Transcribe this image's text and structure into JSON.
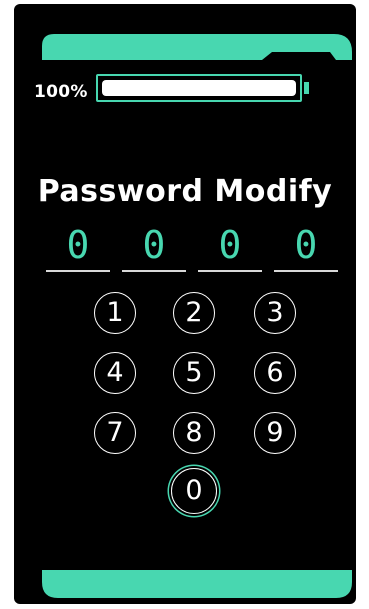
{
  "colors": {
    "accent": "#48d7b0",
    "background": "#000000",
    "text": "#ffffff"
  },
  "battery": {
    "label": "100%",
    "level": 1.0
  },
  "title": "Password Modify",
  "pin": {
    "digits": [
      "0",
      "0",
      "0",
      "0"
    ]
  },
  "keypad": {
    "keys": [
      "1",
      "2",
      "3",
      "4",
      "5",
      "6",
      "7",
      "8",
      "9",
      "0"
    ],
    "focused_key": "0"
  }
}
